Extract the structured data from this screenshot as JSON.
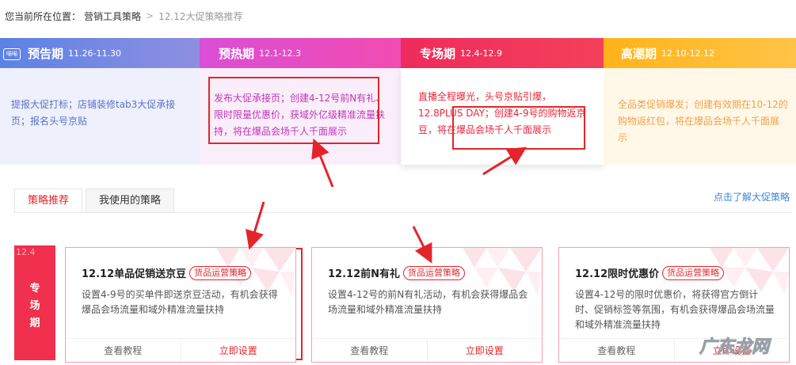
{
  "breadcrumb": {
    "lead": "您当前所在位置：",
    "crumb1": "营销工具策略",
    "sep": ">",
    "current": "12.12大促策略推荐"
  },
  "phases": [
    {
      "name": "预告期",
      "dates": "11.26-11.30",
      "desc": "提报大促打标；店铺装修tab3大促承接页；报名头号京贴",
      "color": "#5b82e6",
      "logo": "喵喵"
    },
    {
      "name": "预热期",
      "dates": "12.1-12.3",
      "desc": "发布大促承接页；创建4-12号前N有礼、限时限量优惠价，获域外亿级精准流量扶持，将在爆品会场千人千面展示",
      "color": "#e24ac8"
    },
    {
      "name": "专场期",
      "dates": "12.4-12.9",
      "desc": "直播全程曝光，头号京贴引爆，12.8PLUS DAY；创建4-9号的购物返京豆，将在爆品会场千人千面展示",
      "color": "#ee2b5c"
    },
    {
      "name": "高潮期",
      "dates": "12.10-12.12",
      "desc": "全品类促销爆发；创建有效期在10-12的购物返红包，将在爆品会场千人千面展示",
      "color": "#ffb31a"
    }
  ],
  "tabs": [
    {
      "label": "策略推荐",
      "active": true
    },
    {
      "label": "我使用的策略",
      "active": false
    }
  ],
  "more_link": "点击了解大促策略",
  "side_tag": {
    "date": "12.4",
    "label": [
      "专",
      "场",
      "期"
    ]
  },
  "cards": [
    {
      "title": "12.12单品促销送京豆",
      "badge": "货品运营策略",
      "desc": "设置4-9号的买单件即送京豆活动，有机会获得爆品会场流量和域外精准流量扶持",
      "tutorial": "查看教程",
      "action": "立即设置"
    },
    {
      "title": "12.12前N有礼",
      "badge": "货品运营策略",
      "desc": "设置4-12号的前N有礼活动，有机会获得爆品会场流量和域外精准流量扶持",
      "tutorial": "查看教程",
      "action": "立即设置"
    },
    {
      "title": "12.12限时优惠价",
      "badge": "货品运营策略",
      "desc": "设置4-12号的限时优惠价，将获得官方倒计时、促销标签等氛围，有机会获得爆品会场流量和域外精准流量扶持",
      "tutorial": "查看教程",
      "action": "立即设置"
    }
  ],
  "watermark": "广东龙网",
  "colors": {
    "accent": "#e3252b",
    "link": "#3a86d6",
    "card_border": "#f2a0ae"
  }
}
